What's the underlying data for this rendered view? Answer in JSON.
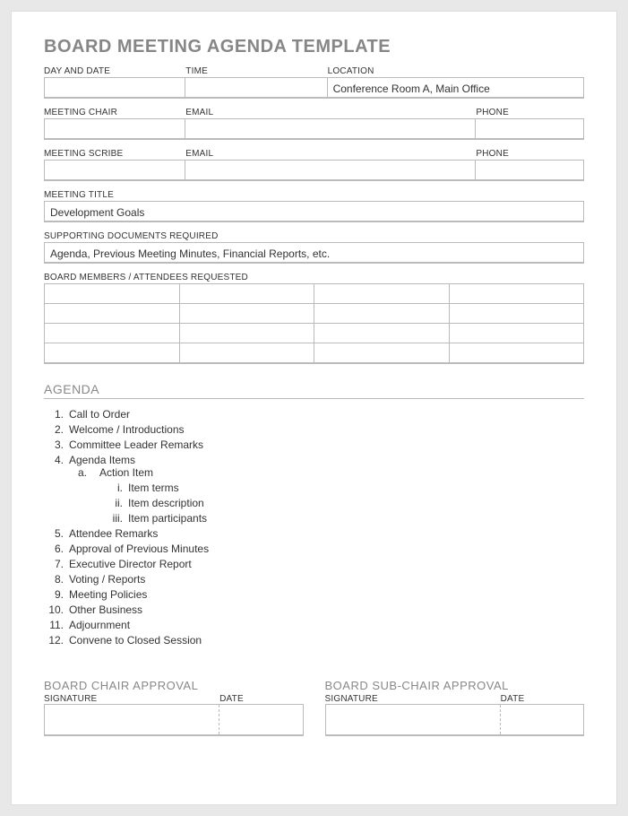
{
  "title": "BOARD MEETING AGENDA TEMPLATE",
  "fields": {
    "day_and_date": {
      "label": "DAY AND DATE",
      "value": ""
    },
    "time": {
      "label": "TIME",
      "value": ""
    },
    "location": {
      "label": "LOCATION",
      "value": "Conference Room A, Main Office"
    },
    "meeting_chair": {
      "label": "MEETING CHAIR",
      "value": ""
    },
    "chair_email": {
      "label": "EMAIL",
      "value": ""
    },
    "chair_phone": {
      "label": "PHONE",
      "value": ""
    },
    "meeting_scribe": {
      "label": "MEETING SCRIBE",
      "value": ""
    },
    "scribe_email": {
      "label": "EMAIL",
      "value": ""
    },
    "scribe_phone": {
      "label": "PHONE",
      "value": ""
    },
    "meeting_title": {
      "label": "MEETING TITLE",
      "value": "Development Goals"
    },
    "supporting_docs": {
      "label": "SUPPORTING DOCUMENTS REQUIRED",
      "value": "Agenda, Previous Meeting Minutes, Financial Reports, etc."
    },
    "attendees_label": "BOARD MEMBERS / ATTENDEES REQUESTED"
  },
  "agenda": {
    "heading": "AGENDA",
    "items": [
      "Call to Order",
      "Welcome / Introductions",
      "Committee Leader Remarks",
      "Agenda Items",
      "Attendee Remarks",
      "Approval of Previous Minutes",
      "Executive Director Report",
      "Voting / Reports",
      "Meeting Policies",
      "Other Business",
      "Adjournment",
      "Convene to Closed Session"
    ],
    "sub_a": {
      "label": "a.",
      "text": "Action Item"
    },
    "sub_i": [
      {
        "label": "i.",
        "text": "Item terms"
      },
      {
        "label": "ii.",
        "text": "Item description"
      },
      {
        "label": "iii.",
        "text": "Item participants"
      }
    ]
  },
  "approval": {
    "chair": {
      "heading": "BOARD CHAIR APPROVAL",
      "signature_label": "SIGNATURE",
      "date_label": "DATE"
    },
    "subchair": {
      "heading": "BOARD SUB-CHAIR APPROVAL",
      "signature_label": "SIGNATURE",
      "date_label": "DATE"
    }
  }
}
